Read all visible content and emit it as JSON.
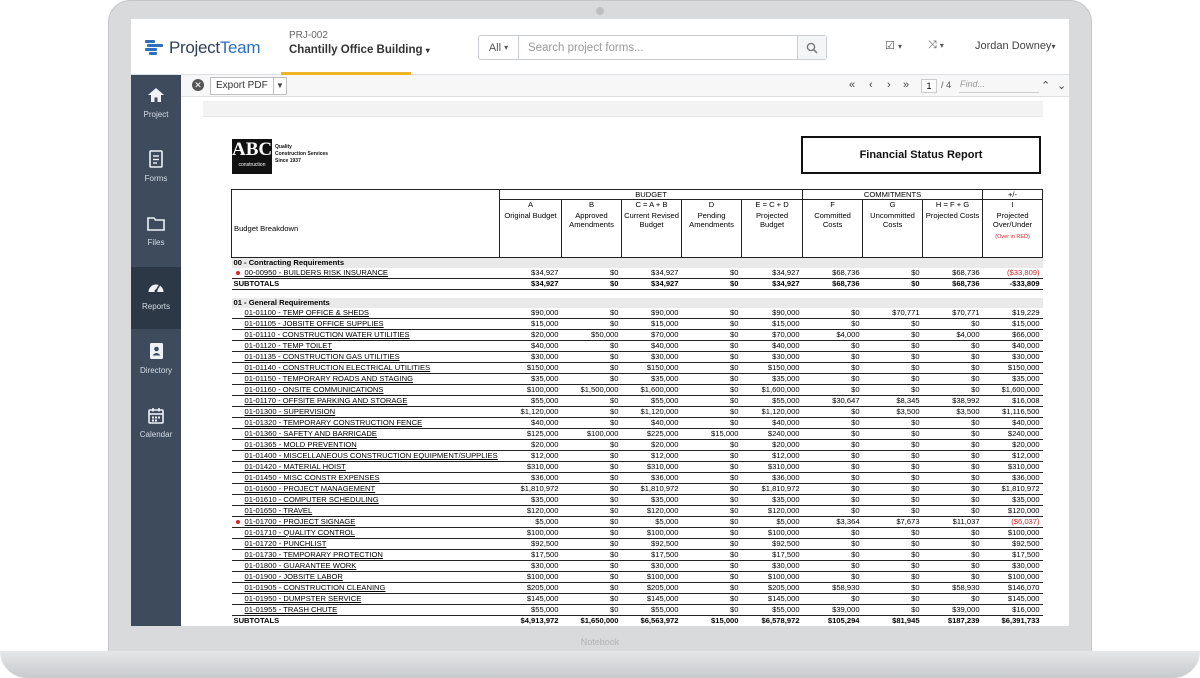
{
  "device": {
    "brand_label": "Notebook"
  },
  "header": {
    "logo_text_1": "Project",
    "logo_text_2": "Team",
    "project_code": "PRJ-002",
    "project_name": "Chantilly Office Building",
    "search_scope": "All",
    "search_placeholder": "Search project forms...",
    "user_name": "Jordan Downey"
  },
  "sidebar": {
    "items": [
      {
        "label": "Project",
        "icon": "home-icon"
      },
      {
        "label": "Forms",
        "icon": "forms-icon"
      },
      {
        "label": "Files",
        "icon": "folder-icon"
      },
      {
        "label": "Reports",
        "icon": "gauge-icon",
        "active": true
      },
      {
        "label": "Directory",
        "icon": "directory-icon"
      },
      {
        "label": "Calendar",
        "icon": "calendar-icon"
      }
    ]
  },
  "toolbar": {
    "export_label": "Export PDF",
    "page_current": "1",
    "page_total": "/ 4",
    "find_placeholder": "Find..."
  },
  "report": {
    "company_abbr": "ABC",
    "company_sub": "construction",
    "tagline": [
      "Quality",
      "Construction Services",
      "Since 1937"
    ],
    "title": "Financial Status Report",
    "group_budget": "BUDGET",
    "group_commitments": "COMMITMENTS",
    "group_variance": "+/-",
    "col_first": "Budget Breakdown",
    "columns": [
      {
        "letter": "A",
        "label": "Original Budget"
      },
      {
        "letter": "B",
        "label": "Approved Amendments"
      },
      {
        "letter": "C = A + B",
        "label": "Current Revised Budget"
      },
      {
        "letter": "D",
        "label": "Pending Amendments"
      },
      {
        "letter": "E = C + D",
        "label": "Projected Budget"
      },
      {
        "letter": "F",
        "label": "Committed Costs"
      },
      {
        "letter": "G",
        "label": "Uncommitted Costs"
      },
      {
        "letter": "H = F + G",
        "label": "Projected Costs"
      },
      {
        "letter": "I",
        "label": "Projected Over/Under"
      }
    ],
    "over_note": "(Over in RED)",
    "sections": [
      {
        "title": "00 - Contracting Requirements",
        "rows": [
          {
            "label": "00-00950 - BUILDERS RISK INSURANCE",
            "flag": true,
            "values": [
              "$34,927",
              "$0",
              "$34,927",
              "$0",
              "$34,927",
              "$68,736",
              "$0",
              "$68,736",
              "($33,809)"
            ],
            "red": true
          }
        ],
        "subtotal": {
          "label": "SUBTOTALS",
          "values": [
            "$34,927",
            "$0",
            "$34,927",
            "$0",
            "$34,927",
            "$68,736",
            "$0",
            "$68,736",
            "-$33,809"
          ]
        }
      },
      {
        "title": "01 - General Requirements",
        "rows": [
          {
            "label": "01-01100 - TEMP OFFICE & SHEDS",
            "values": [
              "$90,000",
              "$0",
              "$90,000",
              "$0",
              "$90,000",
              "$0",
              "$70,771",
              "$70,771",
              "$19,229"
            ]
          },
          {
            "label": "01-01105 - JOBSITE OFFICE SUPPLIES",
            "values": [
              "$15,000",
              "$0",
              "$15,000",
              "$0",
              "$15,000",
              "$0",
              "$0",
              "$0",
              "$15,000"
            ]
          },
          {
            "label": "01-01110 - CONSTRUCTION WATER UTILITIES",
            "values": [
              "$20,000",
              "$50,000",
              "$70,000",
              "$0",
              "$70,000",
              "$4,000",
              "$0",
              "$4,000",
              "$66,000"
            ]
          },
          {
            "label": "01-01120 - TEMP TOILET",
            "values": [
              "$40,000",
              "$0",
              "$40,000",
              "$0",
              "$40,000",
              "$0",
              "$0",
              "$0",
              "$40,000"
            ]
          },
          {
            "label": "01-01135 - CONSTRUCTION GAS UTILITIES",
            "values": [
              "$30,000",
              "$0",
              "$30,000",
              "$0",
              "$30,000",
              "$0",
              "$0",
              "$0",
              "$30,000"
            ]
          },
          {
            "label": "01-01140 - CONSTRUCTION ELECTRICAL UTILITIES",
            "values": [
              "$150,000",
              "$0",
              "$150,000",
              "$0",
              "$150,000",
              "$0",
              "$0",
              "$0",
              "$150,000"
            ]
          },
          {
            "label": "01-01150 - TEMPORARY ROADS AND STAGING",
            "values": [
              "$35,000",
              "$0",
              "$35,000",
              "$0",
              "$35,000",
              "$0",
              "$0",
              "$0",
              "$35,000"
            ]
          },
          {
            "label": "01-01160 - ONSITE COMMUNICATIONS",
            "values": [
              "$100,000",
              "$1,500,000",
              "$1,600,000",
              "$0",
              "$1,600,000",
              "$0",
              "$0",
              "$0",
              "$1,600,000"
            ]
          },
          {
            "label": "01-01170 - OFFSITE PARKING AND STORAGE",
            "values": [
              "$55,000",
              "$0",
              "$55,000",
              "$0",
              "$55,000",
              "$30,647",
              "$8,345",
              "$38,992",
              "$16,008"
            ]
          },
          {
            "label": "01-01300 - SUPERVISION",
            "values": [
              "$1,120,000",
              "$0",
              "$1,120,000",
              "$0",
              "$1,120,000",
              "$0",
              "$3,500",
              "$3,500",
              "$1,116,500"
            ]
          },
          {
            "label": "01-01320 - TEMPORARY CONSTRUCTION FENCE",
            "values": [
              "$40,000",
              "$0",
              "$40,000",
              "$0",
              "$40,000",
              "$0",
              "$0",
              "$0",
              "$40,000"
            ]
          },
          {
            "label": "01-01360 - SAFETY AND BARRICADE",
            "values": [
              "$125,000",
              "$100,000",
              "$225,000",
              "$15,000",
              "$240,000",
              "$0",
              "$0",
              "$0",
              "$240,000"
            ]
          },
          {
            "label": "01-01365 - MOLD PREVENTION",
            "values": [
              "$20,000",
              "$0",
              "$20,000",
              "$0",
              "$20,000",
              "$0",
              "$0",
              "$0",
              "$20,000"
            ]
          },
          {
            "label": "01-01400 - MISCELLANEOUS CONSTRUCTION EQUIPMENT/SUPPLIES",
            "wrap": true,
            "values": [
              "$12,000",
              "$0",
              "$12,000",
              "$0",
              "$12,000",
              "$0",
              "$0",
              "$0",
              "$12,000"
            ]
          },
          {
            "label": "01-01420 - MATERIAL HOIST",
            "values": [
              "$310,000",
              "$0",
              "$310,000",
              "$0",
              "$310,000",
              "$0",
              "$0",
              "$0",
              "$310,000"
            ]
          },
          {
            "label": "01-01450 - MISC CONSTR EXPENSES",
            "values": [
              "$36,000",
              "$0",
              "$36,000",
              "$0",
              "$36,000",
              "$0",
              "$0",
              "$0",
              "$36,000"
            ]
          },
          {
            "label": "01-01600 - PROJECT MANAGEMENT",
            "values": [
              "$1,810,972",
              "$0",
              "$1,810,972",
              "$0",
              "$1,810,972",
              "$0",
              "$0",
              "$0",
              "$1,810,972"
            ]
          },
          {
            "label": "01-01610 - COMPUTER SCHEDULING",
            "values": [
              "$35,000",
              "$0",
              "$35,000",
              "$0",
              "$35,000",
              "$0",
              "$0",
              "$0",
              "$35,000"
            ]
          },
          {
            "label": "01-01650 - TRAVEL",
            "values": [
              "$120,000",
              "$0",
              "$120,000",
              "$0",
              "$120,000",
              "$0",
              "$0",
              "$0",
              "$120,000"
            ]
          },
          {
            "label": "01-01700 - PROJECT SIGNAGE",
            "flag": true,
            "red": true,
            "values": [
              "$5,000",
              "$0",
              "$5,000",
              "$0",
              "$5,000",
              "$3,364",
              "$7,673",
              "$11,037",
              "($6,037)"
            ]
          },
          {
            "label": "01-01710 - QUALITY CONTROL",
            "values": [
              "$100,000",
              "$0",
              "$100,000",
              "$0",
              "$100,000",
              "$0",
              "$0",
              "$0",
              "$100,000"
            ]
          },
          {
            "label": "01-01720 - PUNCHLIST",
            "values": [
              "$92,500",
              "$0",
              "$92,500",
              "$0",
              "$92,500",
              "$0",
              "$0",
              "$0",
              "$92,500"
            ]
          },
          {
            "label": "01-01730 - TEMPORARY PROTECTION",
            "values": [
              "$17,500",
              "$0",
              "$17,500",
              "$0",
              "$17,500",
              "$0",
              "$0",
              "$0",
              "$17,500"
            ]
          },
          {
            "label": "01-01800 - GUARANTEE WORK",
            "values": [
              "$30,000",
              "$0",
              "$30,000",
              "$0",
              "$30,000",
              "$0",
              "$0",
              "$0",
              "$30,000"
            ]
          },
          {
            "label": "01-01900 - JOBSITE LABOR",
            "values": [
              "$100,000",
              "$0",
              "$100,000",
              "$0",
              "$100,000",
              "$0",
              "$0",
              "$0",
              "$100,000"
            ]
          },
          {
            "label": "01-01905 - CONSTRUCTION CLEANING",
            "values": [
              "$205,000",
              "$0",
              "$205,000",
              "$0",
              "$205,000",
              "$58,930",
              "$0",
              "$58,930",
              "$146,070"
            ]
          },
          {
            "label": "01-01950 - DUMPSTER SERVICE",
            "values": [
              "$145,000",
              "$0",
              "$145,000",
              "$0",
              "$145,000",
              "$0",
              "$0",
              "$0",
              "$145,000"
            ]
          },
          {
            "label": "01-01955 - TRASH CHUTE",
            "values": [
              "$55,000",
              "$0",
              "$55,000",
              "$0",
              "$55,000",
              "$39,000",
              "$0",
              "$39,000",
              "$16,000"
            ]
          }
        ],
        "subtotal": {
          "label": "SUBTOTALS",
          "values": [
            "$4,913,972",
            "$1,650,000",
            "$6,563,972",
            "$15,000",
            "$6,578,972",
            "$105,294",
            "$81,945",
            "$187,239",
            "$6,391,733"
          ]
        }
      }
    ]
  }
}
